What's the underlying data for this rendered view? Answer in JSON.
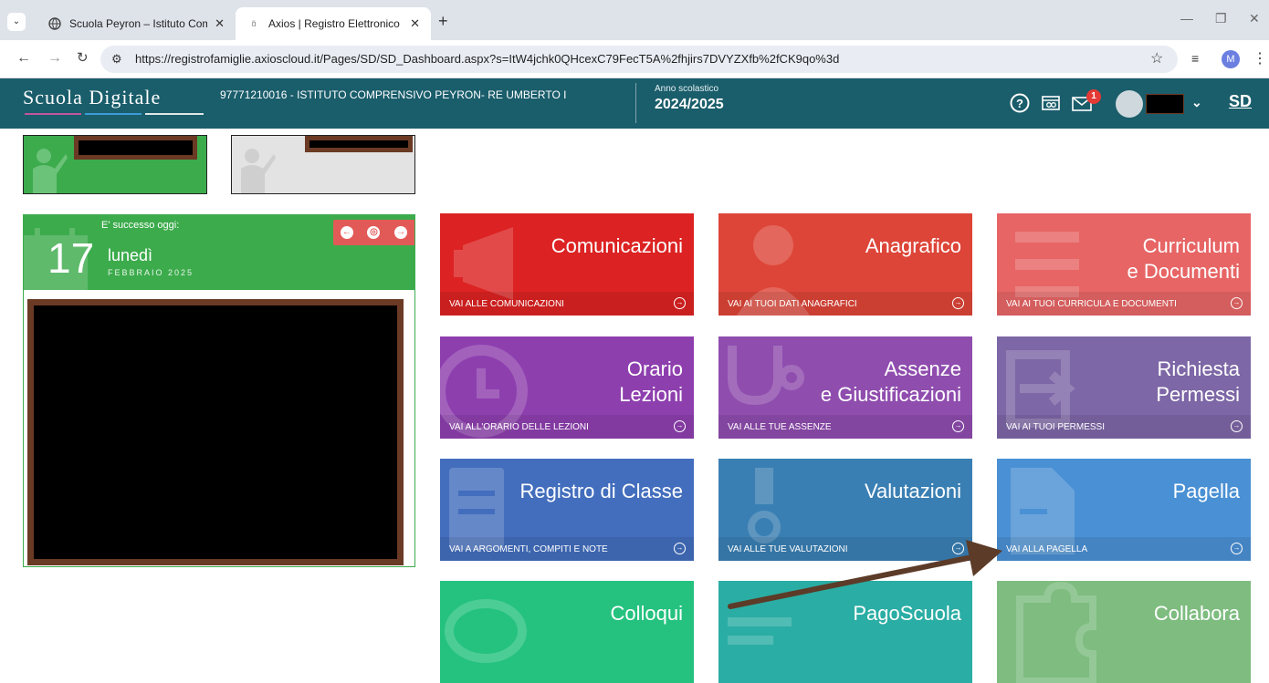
{
  "browser": {
    "tabs": [
      {
        "title": "Scuola Peyron – Istituto Compr",
        "active": false
      },
      {
        "title": "Axios | Registro Elettronico Fam",
        "active": true
      }
    ],
    "new_tab": "+",
    "url": "https://registrofamiglie.axioscloud.it/Pages/SD/SD_Dashboard.aspx?s=ItW4jchk0QHcexC79FecT5A%2fhjirs7DVYZXfb%2fCK9qo%3d",
    "profile_initial": "M"
  },
  "header": {
    "logo": "Scuola Digitale",
    "school": "97771210016 - ISTITUTO COMPRENSIVO PEYRON- RE UMBERTO I",
    "year_label": "Anno scolastico",
    "year_value": "2024/2025",
    "messages_badge": "1",
    "sd_label": "SD",
    "logo_colors": [
      "#c2569b",
      "#3c9ad6",
      "#e0e0e0"
    ]
  },
  "calendar": {
    "today_label": "E' successo oggi:",
    "day": "17",
    "weekday": "lunedì",
    "month_year": "FEBBRAIO 2025"
  },
  "tiles": [
    {
      "title": "Comunicazioni",
      "footer": "VAI ALLE COMUNICAZIONI",
      "color": "#dc2222",
      "icon": "megaphone-icon"
    },
    {
      "title": "Anagrafico",
      "footer": "VAI AI TUOI DATI ANAGRAFICI",
      "color": "#dd4538",
      "icon": "person-icon"
    },
    {
      "title": "Curriculum\ne Documenti",
      "footer": "VAI AI TUOI CURRICULA E DOCUMENTI",
      "color": "#e76565",
      "icon": "document-lines-icon"
    },
    {
      "title": "Orario\nLezioni",
      "footer": "VAI ALL'ORARIO DELLE LEZIONI",
      "color": "#8e3fae",
      "icon": "clock-icon"
    },
    {
      "title": "Assenze\ne Giustificazioni",
      "footer": "VAI ALLE TUE ASSENZE",
      "color": "#8f4dae",
      "icon": "stethoscope-icon"
    },
    {
      "title": "Richiesta\nPermessi",
      "footer": "VAI AI TUOI PERMESSI",
      "color": "#7d67a6",
      "icon": "exit-icon"
    },
    {
      "title": "Registro di Classe",
      "footer": "VAI A ARGOMENTI, COMPITI E NOTE",
      "color": "#436ebd",
      "icon": "register-icon"
    },
    {
      "title": "Valutazioni",
      "footer": "VAI ALLE TUE VALUTAZIONI",
      "color": "#3a7fb3",
      "icon": "grade-icon"
    },
    {
      "title": "Pagella",
      "footer": "VAI ALLA PAGELLA",
      "color": "#4a90d4",
      "icon": "report-card-icon"
    },
    {
      "title": "Colloqui",
      "footer": "",
      "color": "#25c27f",
      "icon": "chat-icon"
    },
    {
      "title": "PagoScuola",
      "footer": "",
      "color": "#2aada4",
      "icon": "payment-icon"
    },
    {
      "title": "Collabora",
      "footer": "",
      "color": "#7ebc80",
      "icon": "puzzle-icon"
    }
  ],
  "annotation_arrow_color": "#5c3b28"
}
